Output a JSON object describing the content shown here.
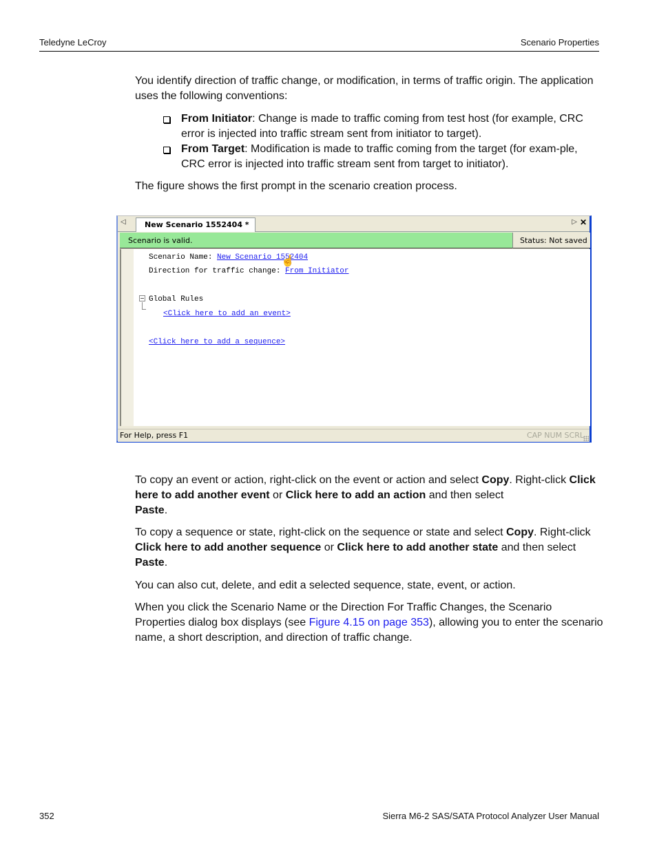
{
  "header": {
    "left": "Teledyne LeCroy",
    "right": "Scenario Properties"
  },
  "footer": {
    "page_number": "352",
    "manual_title": "Sierra M6-2 SAS/SATA Protocol Analyzer User Manual"
  },
  "intro": {
    "text": "You identify direction of traffic change, or modification, in terms of traffic origin. The application uses the following conventions:"
  },
  "bullets": [
    {
      "icon": "checkbox-bullet-icon",
      "term": "From Initiator",
      "text": ": Change is made to traffic coming from test host (for example, CRC error is injected into traffic stream sent from initiator to target)."
    },
    {
      "icon": "checkbox-bullet-icon",
      "term": "From Target",
      "text": ": Modification is made to traffic coming from the target (for exam-ple, CRC error is injected into traffic stream sent from target to initiator)."
    }
  ],
  "figure_caption_text": "The figure shows the first prompt in the scenario creation process.",
  "screenshot": {
    "tab_label": "New Scenario 1552404 *",
    "left_arrow_icon": "◁",
    "right_arrow_icon": "▷",
    "close_icon": "✕",
    "valid_message": "Scenario is valid.",
    "valid_color": "#98e898",
    "status_text": "Status: Not saved",
    "scenario_name_label": "Scenario Name: ",
    "scenario_name_value": "New Scenario 1552404",
    "direction_label": "Direction for traffic change: ",
    "direction_value": "From Initiator",
    "global_rules_label": "Global Rules",
    "add_event_link": "<Click here to add an event>",
    "add_sequence_link": "<Click here to add a sequence>",
    "help_text": "For Help, press F1",
    "indicators": "CAP  NUM  SCRL",
    "link_color": "#1a1aee"
  },
  "para_copy_event": {
    "t1": "To copy an event or action, right-click on the event or action and select ",
    "b1": "Copy",
    "t2": ". Right-click ",
    "b2": "Click here to add another event",
    "t3": " or ",
    "b3": "Click here to add an action",
    "t4": " and then select ",
    "b4": "Paste",
    "t5": "."
  },
  "para_copy_sequence": {
    "t1": "To copy a sequence or state, right-click on the sequence or state and select ",
    "b1": "Copy",
    "t2": ". Right-click ",
    "b2": "Click here to add another sequence",
    "t3": " or ",
    "b3": "Click here to add another state",
    "t4": " and then select ",
    "b4": "Paste",
    "t5": "."
  },
  "para_cut": "You can also cut, delete, and edit a selected sequence, state, event, or action.",
  "para_click": {
    "t1": "When you click the Scenario Name or the Direction For Traffic Changes, the Scenario Properties dialog box displays (see ",
    "link": "Figure 4.15 on page 353",
    "t2": "), allowing you to enter the scenario name, a short description, and direction of traffic change."
  }
}
